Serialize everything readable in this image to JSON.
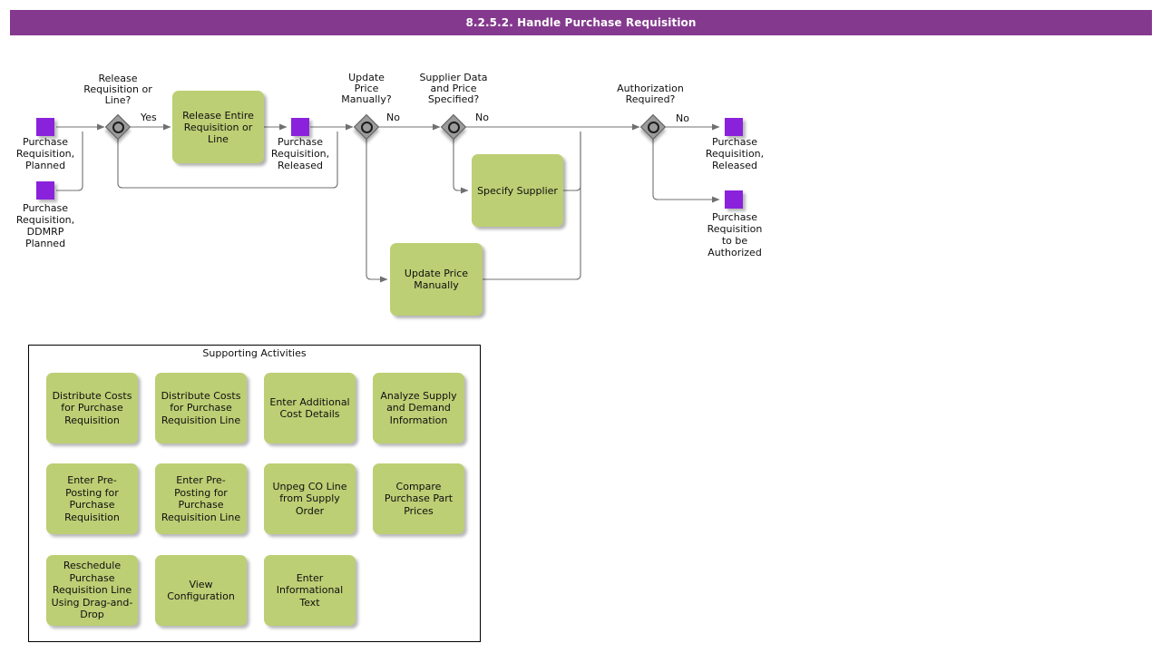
{
  "header": {
    "title": "8.2.5.2. Handle Purchase Requisition",
    "bar_color": "#84398E"
  },
  "palette": {
    "event_purple": "#8A22DC",
    "task_green": "#BCCF74",
    "gateway_grey": "#9B9B9B",
    "connector": "#707070"
  },
  "diagram": {
    "events": [
      {
        "id": "ev-pr-planned",
        "label": "Purchase\nRequisition,\nPlanned"
      },
      {
        "id": "ev-pr-ddmrp",
        "label": "Purchase\nRequisition,\nDDMRP\nPlanned"
      },
      {
        "id": "ev-pr-released-mid",
        "label": "Purchase\nRequisition,\nReleased"
      },
      {
        "id": "ev-pr-released-end",
        "label": "Purchase\nRequisition,\nReleased"
      },
      {
        "id": "ev-pr-to-auth",
        "label": "Purchase\nRequisition\nto be\nAuthorized"
      }
    ],
    "gateways": [
      {
        "id": "gw-release",
        "label": "Release\nRequisition or\nLine?"
      },
      {
        "id": "gw-price",
        "label": "Update\nPrice\nManually?"
      },
      {
        "id": "gw-supplier",
        "label": "Supplier Data\nand Price\nSpecified?"
      },
      {
        "id": "gw-auth",
        "label": "Authorization\nRequired?"
      }
    ],
    "tasks": [
      {
        "id": "task-release-entire",
        "label": "Release Entire\nRequisition or\nLine"
      },
      {
        "id": "task-specify-supplier",
        "label": "Specify Supplier"
      },
      {
        "id": "task-update-price",
        "label": "Update Price\nManually"
      }
    ],
    "flow_labels": [
      {
        "id": "flow-yes-release",
        "text": "Yes"
      },
      {
        "id": "flow-no-price",
        "text": "No"
      },
      {
        "id": "flow-no-supplier",
        "text": "No"
      },
      {
        "id": "flow-no-auth",
        "text": "No"
      }
    ]
  },
  "supporting": {
    "title": "Supporting Activities",
    "items": [
      {
        "label": "Distribute Costs\nfor Purchase\nRequisition"
      },
      {
        "label": "Distribute Costs\nfor Purchase\nRequisition Line"
      },
      {
        "label": "Enter Additional\nCost Details"
      },
      {
        "label": "Analyze Supply\nand Demand\nInformation"
      },
      {
        "label": "Enter Pre-\nPosting for\nPurchase\nRequisition"
      },
      {
        "label": "Enter Pre-\nPosting for\nPurchase\nRequisition Line"
      },
      {
        "label": "Unpeg CO Line\nfrom Supply\nOrder"
      },
      {
        "label": "Compare\nPurchase Part\nPrices"
      },
      {
        "label": "Reschedule\nPurchase\nRequisition Line\nUsing Drag-and-\nDrop"
      },
      {
        "label": "View\nConfiguration"
      },
      {
        "label": "Enter\nInformational\nText"
      }
    ]
  }
}
